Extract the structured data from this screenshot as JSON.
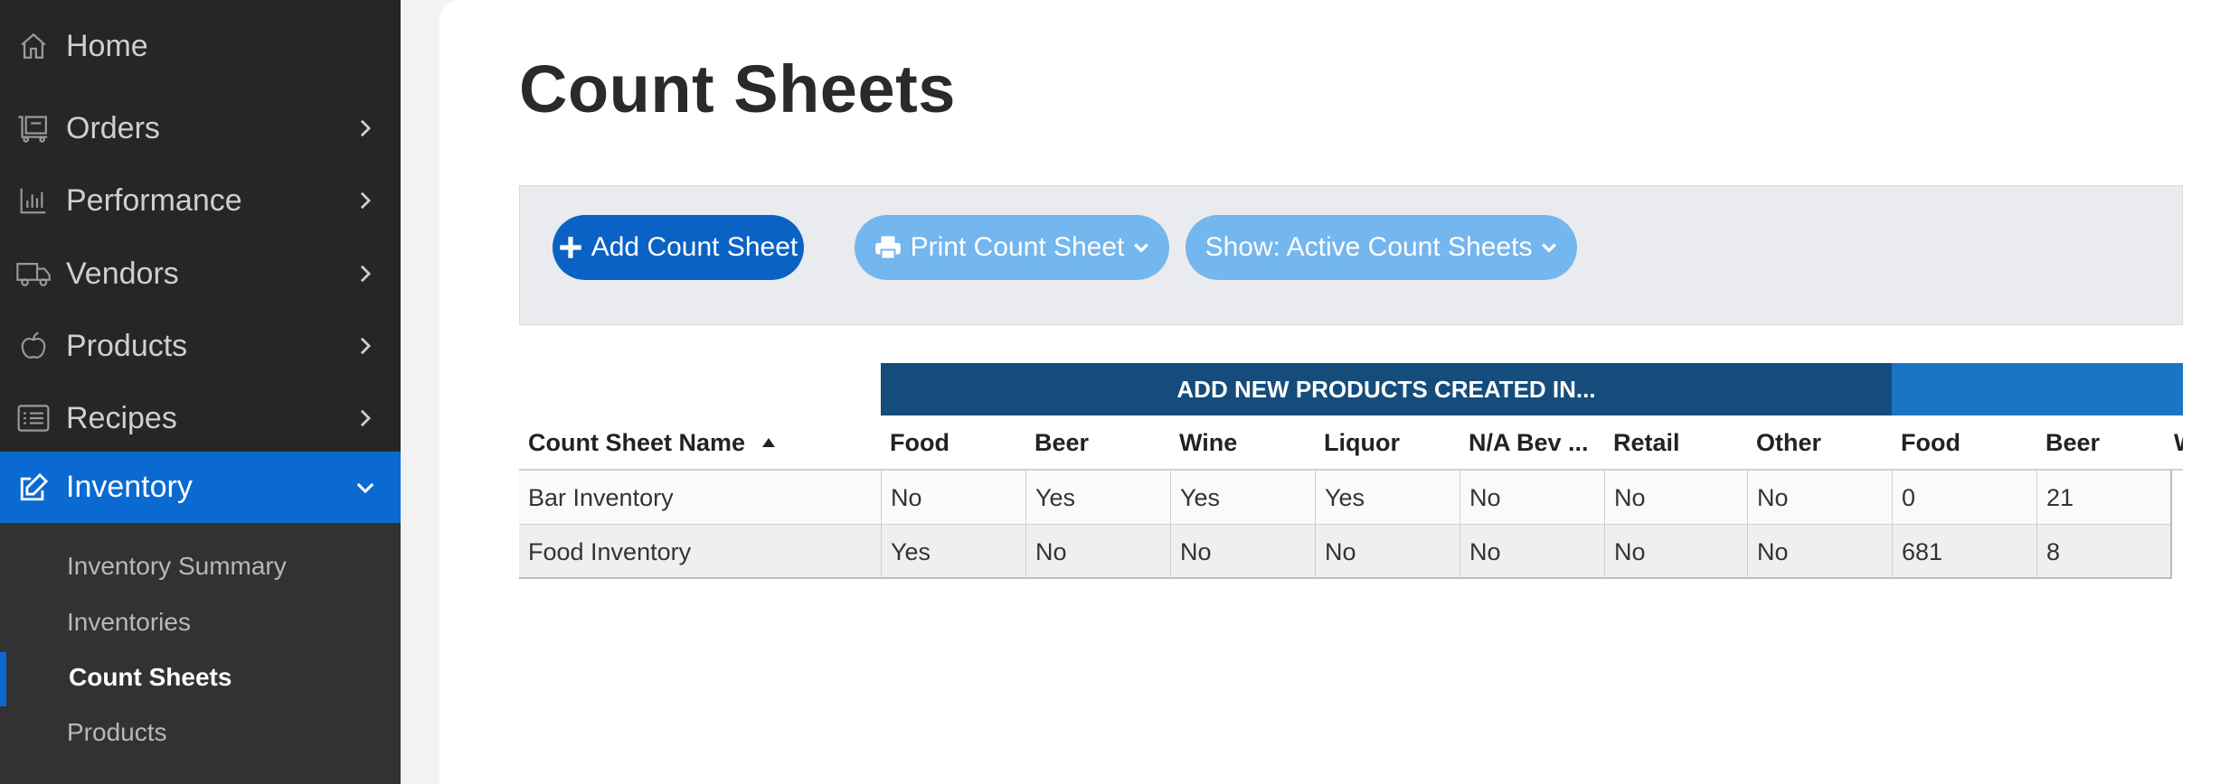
{
  "sidebar": {
    "items": [
      {
        "label": "Home",
        "icon": "home-icon"
      },
      {
        "label": "Orders",
        "icon": "orders-icon"
      },
      {
        "label": "Performance",
        "icon": "bar-chart-icon"
      },
      {
        "label": "Vendors",
        "icon": "truck-icon"
      },
      {
        "label": "Products",
        "icon": "apple-icon"
      },
      {
        "label": "Recipes",
        "icon": "list-icon"
      },
      {
        "label": "Inventory",
        "icon": "edit-icon",
        "active": true
      }
    ],
    "subitems": [
      {
        "label": "Inventory Summary"
      },
      {
        "label": "Inventories"
      },
      {
        "label": "Count Sheets",
        "current": true
      },
      {
        "label": "Products"
      }
    ]
  },
  "main": {
    "title": "Count Sheets",
    "toolbar": {
      "add_label": "Add Count Sheet",
      "print_label": "Print Count Sheet",
      "show_label": "Show: Active Count Sheets"
    },
    "table": {
      "group_header": "ADD NEW PRODUCTS CREATED IN...",
      "columns": [
        "Count Sheet Name",
        "Food",
        "Beer",
        "Wine",
        "Liquor",
        "N/A Bev ...",
        "Retail",
        "Other",
        "Food",
        "Beer",
        "W"
      ],
      "rows": [
        [
          "Bar Inventory",
          "No",
          "Yes",
          "Yes",
          "Yes",
          "No",
          "No",
          "No",
          "0",
          "21"
        ],
        [
          "Food Inventory",
          "Yes",
          "No",
          "No",
          "No",
          "No",
          "No",
          "No",
          "681",
          "8"
        ]
      ]
    }
  },
  "colors": {
    "sidebar_bg": "#262626",
    "active_blue": "#0a6ad1",
    "primary_button": "#0a63c4",
    "light_button": "#74b6ee",
    "group_header_dark": "#154c7b",
    "group_header_light": "#1b75c5"
  }
}
